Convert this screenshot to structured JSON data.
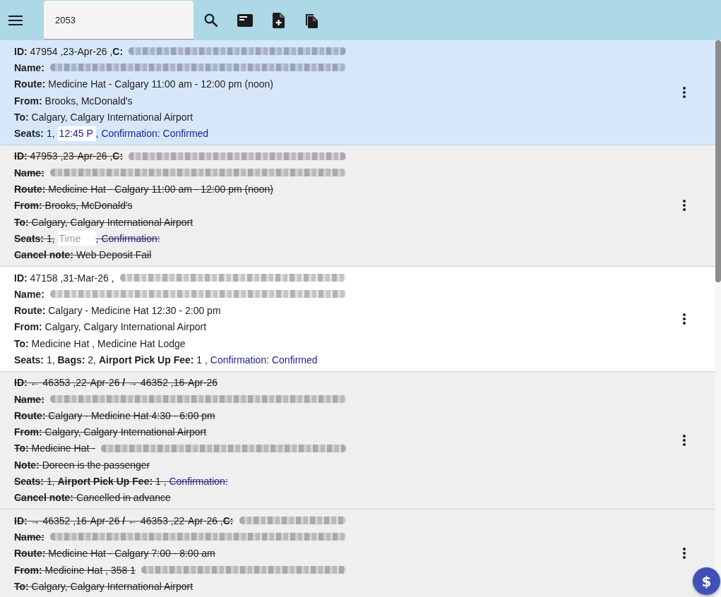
{
  "toolbar": {
    "search": {
      "value": "2053"
    }
  },
  "bookings": [
    {
      "selected": true,
      "cancelled": false,
      "lines": [
        [
          {
            "kind": "text",
            "text": "**ID:** 47954 ,23-Apr-26 ,**C:**"
          },
          {
            "kind": "redacted"
          }
        ],
        [
          {
            "kind": "text",
            "text": "**Name:**"
          },
          {
            "kind": "redacted"
          }
        ],
        [
          {
            "kind": "text",
            "text": "**Route:** Medicine Hat - Calgary 11:00 am - 12:00 pm (noon)"
          }
        ],
        [
          {
            "kind": "text",
            "text": "**From:** Brooks, McDonald's"
          }
        ],
        [
          {
            "kind": "text",
            "text": "**To:** Calgary, Calgary International Airport"
          }
        ],
        [
          {
            "kind": "text",
            "text": "**Seats:** 1,"
          },
          {
            "kind": "time_field",
            "value": "12:45 P"
          },
          {
            "kind": "status",
            "text": ", Confirmation: Confirmed"
          }
        ]
      ]
    },
    {
      "selected": false,
      "cancelled": true,
      "lines": [
        [
          {
            "kind": "text",
            "text": "**ID:** 47953 ,23-Apr-26 ,**C:**"
          },
          {
            "kind": "redacted"
          }
        ],
        [
          {
            "kind": "text",
            "text": "**Name:**"
          },
          {
            "kind": "redacted"
          }
        ],
        [
          {
            "kind": "text",
            "text": "**Route:** Medicine Hat - Calgary 11:00 am - 12:00 pm (noon)"
          }
        ],
        [
          {
            "kind": "text",
            "text": "**From:** Brooks, McDonald's"
          }
        ],
        [
          {
            "kind": "text",
            "text": "**To:** Calgary, Calgary International Airport"
          }
        ],
        [
          {
            "kind": "text",
            "text": "**Seats:** 1,"
          },
          {
            "kind": "time_field",
            "placeholder": "Time"
          },
          {
            "kind": "status",
            "text": ", Confirmation:"
          }
        ],
        [
          {
            "kind": "text",
            "text": "**Cancel note:** Web Deposit Fail"
          }
        ]
      ]
    },
    {
      "selected": false,
      "cancelled": false,
      "lines": [
        [
          {
            "kind": "text",
            "text": "**ID:** 47158 ,31-Mar-26 ,"
          },
          {
            "kind": "redacted"
          }
        ],
        [
          {
            "kind": "text",
            "text": "**Name:**"
          },
          {
            "kind": "redacted"
          }
        ],
        [
          {
            "kind": "text",
            "text": "**Route:** Calgary - Medicine Hat 12:30 - 2:00 pm"
          }
        ],
        [
          {
            "kind": "text",
            "text": "**From:** Calgary, Calgary International Airport"
          }
        ],
        [
          {
            "kind": "text",
            "text": "**To:** Medicine Hat , Medicine Hat Lodge"
          }
        ],
        [
          {
            "kind": "text",
            "text": "**Seats:** 1, **Bags:** 2, **Airport Pick Up Fee:** 1 ,"
          },
          {
            "kind": "status",
            "text": " Confirmation: Confirmed"
          }
        ]
      ]
    },
    {
      "selected": false,
      "cancelled": true,
      "lines": [
        [
          {
            "kind": "text",
            "text": "**ID:** ← 46353 ,22-Apr-26 **/** → 46352 ,16-Apr-26"
          }
        ],
        [
          {
            "kind": "text",
            "text": "**Name:**"
          },
          {
            "kind": "redacted"
          }
        ],
        [
          {
            "kind": "text",
            "text": "**Route:** Calgary - Medicine Hat 4:30 - 6:00 pm"
          }
        ],
        [
          {
            "kind": "text",
            "text": "**From:** Calgary, Calgary International Airport"
          }
        ],
        [
          {
            "kind": "text",
            "text": "**To:** Medicine Hat -"
          },
          {
            "kind": "redacted"
          }
        ],
        [
          {
            "kind": "text",
            "text": "**Note:** Doreen is the passenger"
          }
        ],
        [
          {
            "kind": "text",
            "text": "**Seats:** 1, **Airport Pick Up Fee:** 1 ,"
          },
          {
            "kind": "status",
            "text": " Confirmation:"
          }
        ],
        [
          {
            "kind": "text",
            "text": "**Cancel note:** Cancelled in advance"
          }
        ]
      ]
    },
    {
      "selected": false,
      "cancelled": true,
      "lines": [
        [
          {
            "kind": "text",
            "text": "**ID:** → 46352 ,16-Apr-26 **/** ← 46353 ,22-Apr-26 ,**C:**"
          },
          {
            "kind": "redacted"
          }
        ],
        [
          {
            "kind": "text",
            "text": "**Name:**"
          },
          {
            "kind": "redacted"
          }
        ],
        [
          {
            "kind": "text",
            "text": "**Route:** Medicine Hat - Calgary 7:00 - 8:00 am"
          }
        ],
        [
          {
            "kind": "text",
            "text": "**From:** Medicine Hat , 358 1"
          },
          {
            "kind": "redacted"
          }
        ],
        [
          {
            "kind": "text",
            "text": "**To:** Calgary, Calgary International Airport"
          }
        ]
      ]
    }
  ],
  "fab": {
    "label": "$"
  }
}
